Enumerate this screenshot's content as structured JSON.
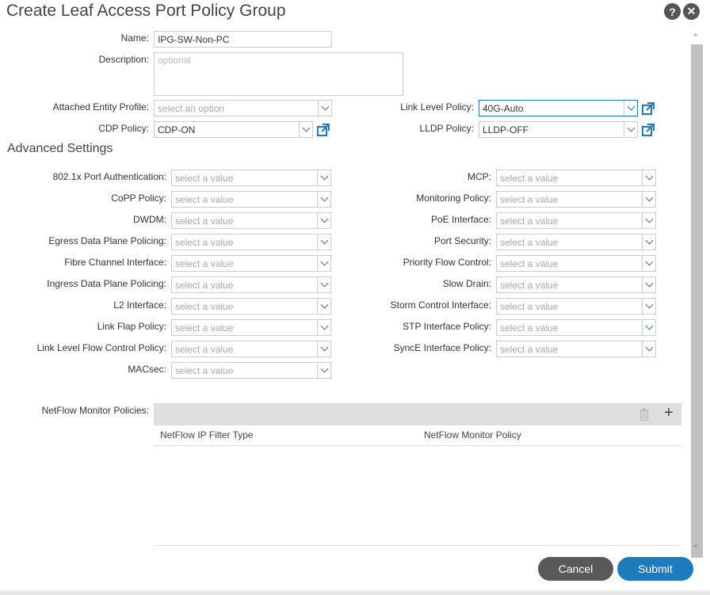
{
  "dialog": {
    "title": "Create Leaf Access Port Policy Group",
    "help_glyph": "?",
    "close_glyph": "✕"
  },
  "general": {
    "name_label": "Name:",
    "name_value": "IPG-SW-Non-PC",
    "description_label": "Description:",
    "description_placeholder": "optional",
    "aep_label": "Attached Entity Profile:",
    "aep_placeholder": "select an option",
    "cdp_label": "CDP Policy:",
    "cdp_value": "CDP-ON",
    "link_level_label": "Link Level Policy:",
    "link_level_value": "40G-Auto",
    "lldp_label": "LLDP Policy:",
    "lldp_value": "LLDP-OFF"
  },
  "advanced": {
    "heading": "Advanced Settings",
    "placeholder": "select a value",
    "left": [
      {
        "label": "802.1x Port Authentication:"
      },
      {
        "label": "CoPP Policy:"
      },
      {
        "label": "DWDM:"
      },
      {
        "label": "Egress Data Plane Policing:"
      },
      {
        "label": "Fibre Channel Interface:"
      },
      {
        "label": "Ingress Data Plane Policing:"
      },
      {
        "label": "L2 Interface:"
      },
      {
        "label": "Link Flap Policy:"
      },
      {
        "label": "Link Level Flow Control Policy:"
      },
      {
        "label": "MACsec:"
      }
    ],
    "right": [
      {
        "label": "MCP:"
      },
      {
        "label": "Monitoring Policy:"
      },
      {
        "label": "PoE Interface:"
      },
      {
        "label": "Port Security:"
      },
      {
        "label": "Priority Flow Control:"
      },
      {
        "label": "Slow Drain:"
      },
      {
        "label": "Storm Control Interface:"
      },
      {
        "label": "STP Interface Policy:"
      },
      {
        "label": "SyncE Interface Policy:"
      }
    ]
  },
  "netflow": {
    "label": "NetFlow Monitor Policies:",
    "col_filter_type": "NetFlow IP Filter Type",
    "col_monitor_policy": "NetFlow Monitor Policy",
    "add_glyph": "+"
  },
  "footer": {
    "cancel_label": "Cancel",
    "submit_label": "Submit"
  },
  "colors": {
    "accent": "#1e7bbd",
    "cancel_bg": "#595959"
  }
}
